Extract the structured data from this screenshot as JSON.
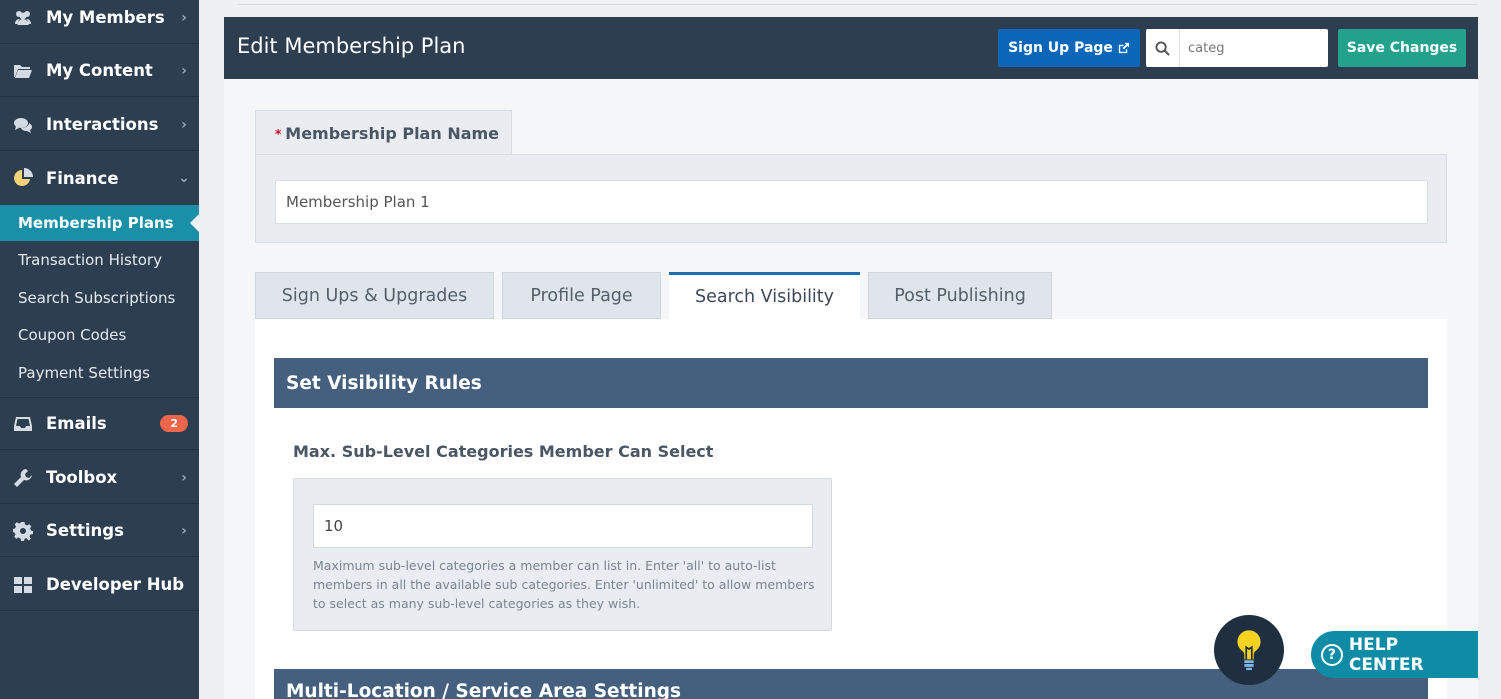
{
  "sidebar": {
    "items": [
      {
        "label": "My Members",
        "icon": "users-icon"
      },
      {
        "label": "My Content",
        "icon": "folder-icon"
      },
      {
        "label": "Interactions",
        "icon": "comments-icon"
      },
      {
        "label": "Finance",
        "icon": "pie-chart-icon"
      },
      {
        "label": "Emails",
        "icon": "inbox-icon",
        "badge": "2"
      },
      {
        "label": "Toolbox",
        "icon": "wrench-icon"
      },
      {
        "label": "Settings",
        "icon": "gear-icon"
      },
      {
        "label": "Developer Hub",
        "icon": "grid-icon"
      }
    ],
    "finance_sub": [
      "Membership Plans",
      "Transaction History",
      "Search Subscriptions",
      "Coupon Codes",
      "Payment Settings"
    ]
  },
  "header": {
    "title": "Edit Membership Plan",
    "signup_label": "Sign Up Page",
    "search_value": "categ",
    "save_label": "Save Changes"
  },
  "plan_name": {
    "required_mark": "*",
    "label": "Membership Plan Name",
    "value": "Membership Plan 1"
  },
  "tabs": [
    "Sign Ups & Upgrades",
    "Profile Page",
    "Search Visibility",
    "Post Publishing"
  ],
  "active_tab": "Search Visibility",
  "visibility": {
    "section_title": "Set Visibility Rules",
    "field_label": "Max. Sub-Level Categories Member Can Select",
    "field_value": "10",
    "help_text": "Maximum sub-level categories a member can list in. Enter 'all' to auto-list members in all the available sub categories. Enter 'unlimited' to allow members to select as many sub-level categories as they wish.",
    "next_section_title": "Multi-Location / Service Area Settings"
  },
  "help_center": {
    "label": "HELP CENTER",
    "icon": "question-circle-icon"
  },
  "colors": {
    "sidebar": "#2c3e50",
    "active_sub": "#1a8fa8",
    "primary": "#0a66b8",
    "success": "#22a18d",
    "section_head": "#44607e",
    "badge": "#f0664a"
  }
}
